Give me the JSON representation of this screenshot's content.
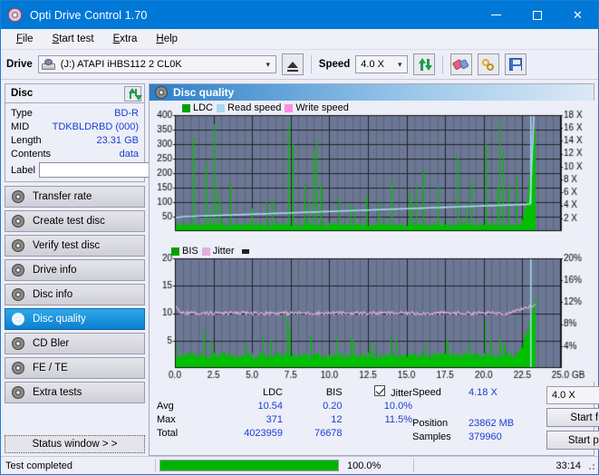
{
  "window": {
    "title": "Opti Drive Control 1.70",
    "icon": "disc-icon",
    "minimize": "minimize",
    "maximize": "maximize",
    "close": "close"
  },
  "menu": [
    {
      "label": "File",
      "accel": "F"
    },
    {
      "label": "Start test",
      "accel": "S"
    },
    {
      "label": "Extra",
      "accel": "E"
    },
    {
      "label": "Help",
      "accel": "H"
    }
  ],
  "toolbar": {
    "drive_label": "Drive",
    "drive_value": "(J:)  ATAPI iHBS112  2 CL0K",
    "eject_title": "eject",
    "speed_label": "Speed",
    "speed_value": "4.0 X",
    "refresh_title": "refresh",
    "erase_title": "erase",
    "tools_title": "tools",
    "save_title": "save"
  },
  "disc": {
    "header": "Disc",
    "refresh_title": "refresh",
    "rows": [
      {
        "label": "Type",
        "value": "BD-R"
      },
      {
        "label": "MID",
        "value": "TDKBLDRBD (000)"
      },
      {
        "label": "Length",
        "value": "23.31 GB"
      },
      {
        "label": "Contents",
        "value": "data"
      }
    ],
    "label_label": "Label",
    "label_value": "",
    "label_placeholder": ""
  },
  "nav": {
    "items": [
      {
        "label": "Transfer rate",
        "active": false
      },
      {
        "label": "Create test disc",
        "active": false
      },
      {
        "label": "Verify test disc",
        "active": false
      },
      {
        "label": "Drive info",
        "active": false
      },
      {
        "label": "Disc info",
        "active": false
      },
      {
        "label": "Disc quality",
        "active": true
      },
      {
        "label": "CD Bler",
        "active": false
      },
      {
        "label": "FE / TE",
        "active": false
      },
      {
        "label": "Extra tests",
        "active": false
      }
    ],
    "status_window": "Status window > >"
  },
  "panel": {
    "title": "Disc quality"
  },
  "stats": {
    "col_ldc": "LDC",
    "col_bis": "BIS",
    "jitter_label": "Jitter",
    "jitter_checked": true,
    "rows": [
      {
        "label": "Avg",
        "ldc": "10.54",
        "bis": "0.20",
        "jitter": "10.0%"
      },
      {
        "label": "Max",
        "ldc": "371",
        "bis": "12",
        "jitter": "11.5%"
      },
      {
        "label": "Total",
        "ldc": "4023959",
        "bis": "76678",
        "jitter": ""
      }
    ],
    "speed_label": "Speed",
    "speed_value": "4.18 X",
    "speed_select": "4.0 X",
    "position_label": "Position",
    "position_value": "23862 MB",
    "samples_label": "Samples",
    "samples_value": "379960",
    "start_full": "Start full",
    "start_part": "Start part"
  },
  "statusbar": {
    "message": "Test completed",
    "progress_percent": 100,
    "percent_text": "100.0%",
    "elapsed": "33:14"
  },
  "colors": {
    "accent": "#0078d7",
    "value_blue": "#1a3fd0",
    "ldc_green": "#00c000",
    "read_speed": "#a8d8f0",
    "write_speed": "#ff8ce0",
    "jitter_pink": "#e0b0e0",
    "plot_bg": "#6b7793",
    "progress_green": "#00b300"
  },
  "chart_data": [
    {
      "type": "line",
      "name": "ldc-chart",
      "title": "",
      "xlabel": "GB",
      "ylabel": "",
      "xlim": [
        0,
        25.0
      ],
      "xticks": [
        "0.0",
        "2.5",
        "5.0",
        "7.5",
        "10.0",
        "12.5",
        "15.0",
        "17.5",
        "20.0",
        "22.5",
        "25.0 GB"
      ],
      "ylim": [
        0,
        400
      ],
      "yticks": [
        "50",
        "100",
        "150",
        "200",
        "250",
        "300",
        "350",
        "400"
      ],
      "y2lim": [
        0,
        18
      ],
      "y2ticks": [
        "2 X",
        "4 X",
        "6 X",
        "8 X",
        "10 X",
        "12 X",
        "14 X",
        "16 X",
        "18 X"
      ],
      "grid": true,
      "legend": [
        {
          "label": "LDC",
          "color": "#00a000"
        },
        {
          "label": "Read speed",
          "color": "#a8d8f0"
        },
        {
          "label": "Write speed",
          "color": "#ff8ce0"
        }
      ],
      "series": [
        {
          "name": "LDC",
          "color": "#00c000",
          "style": "spikes",
          "baseline": 30,
          "note": "dense green spikes across disc, avg 10.54, max 371 near 7.6 GB, heavy rise after 22.5 GB"
        },
        {
          "name": "Read speed",
          "color": "#a8d8f0",
          "style": "step-line",
          "note": "starts ~2.2X rises gradually to ~4.2X by 22 GB then jumps vertically to 18X at 23.1 GB"
        }
      ],
      "data_end_gb": 23.3
    },
    {
      "type": "line",
      "name": "bis-jitter-chart",
      "title": "",
      "xlabel": "GB",
      "ylabel": "",
      "xlim": [
        0,
        25.0
      ],
      "xticks": [
        "0.0",
        "2.5",
        "5.0",
        "7.5",
        "10.0",
        "12.5",
        "15.0",
        "17.5",
        "20.0",
        "22.5",
        "25.0 GB"
      ],
      "ylim": [
        0,
        20
      ],
      "yticks": [
        "5",
        "10",
        "15",
        "20"
      ],
      "y2lim": [
        0,
        20
      ],
      "y2ticks": [
        "4%",
        "8%",
        "12%",
        "16%",
        "20%"
      ],
      "grid": true,
      "legend": [
        {
          "label": "BIS",
          "color": "#00a000"
        },
        {
          "label": "Jitter",
          "color": "#e0b0e0"
        }
      ],
      "series": [
        {
          "name": "BIS",
          "color": "#00c000",
          "style": "spikes",
          "baseline": 2.2,
          "note": "low green noise avg 0.20, max 12, rises toward end of disc"
        },
        {
          "name": "Jitter",
          "color": "#e0b0e0",
          "style": "line",
          "note": "flat noisy line near 10% rising to ~11.5% at end"
        }
      ],
      "data_end_gb": 23.3
    }
  ]
}
